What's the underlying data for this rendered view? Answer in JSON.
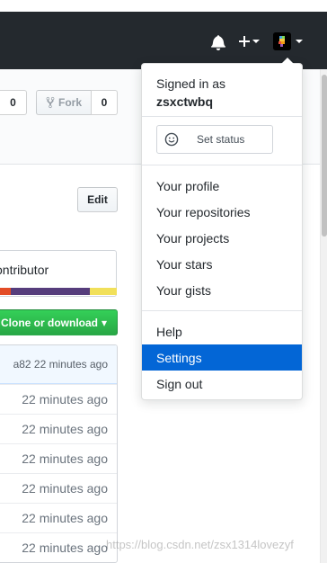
{
  "header": {
    "icons": [
      "bell-icon",
      "plus-icon",
      "avatar"
    ],
    "background": "#24292e"
  },
  "repo_actions": {
    "first_count": "0",
    "fork_label": "Fork",
    "fork_count": "0"
  },
  "readme": {
    "edit_label": "Edit"
  },
  "contributors": {
    "text": "ontributor",
    "language_colors": [
      "#e34c26",
      "#563d7c",
      "#f1e05a"
    ],
    "language_fractions": [
      0.09,
      0.68,
      0.23
    ]
  },
  "clone_button": {
    "label": "Clone or download",
    "caret": "▾"
  },
  "commit_bar": {
    "text": "a82 22 minutes ago"
  },
  "files": [
    {
      "age": "22 minutes ago"
    },
    {
      "age": "22 minutes ago"
    },
    {
      "age": "22 minutes ago"
    },
    {
      "age": "22 minutes ago"
    },
    {
      "age": "22 minutes ago"
    },
    {
      "age": "22 minutes ago"
    }
  ],
  "user_menu": {
    "signed_in_label": "Signed in as",
    "username": "zsxctwbq",
    "set_status_label": "Set status",
    "items": [
      {
        "label": "Your profile"
      },
      {
        "label": "Your repositories"
      },
      {
        "label": "Your projects"
      },
      {
        "label": "Your stars"
      },
      {
        "label": "Your gists"
      }
    ],
    "help_label": "Help",
    "settings_label": "Settings",
    "signout_label": "Sign out",
    "active_color": "#0366d6"
  },
  "watermark": "https://blog.csdn.net/zsx1314lovezyf"
}
